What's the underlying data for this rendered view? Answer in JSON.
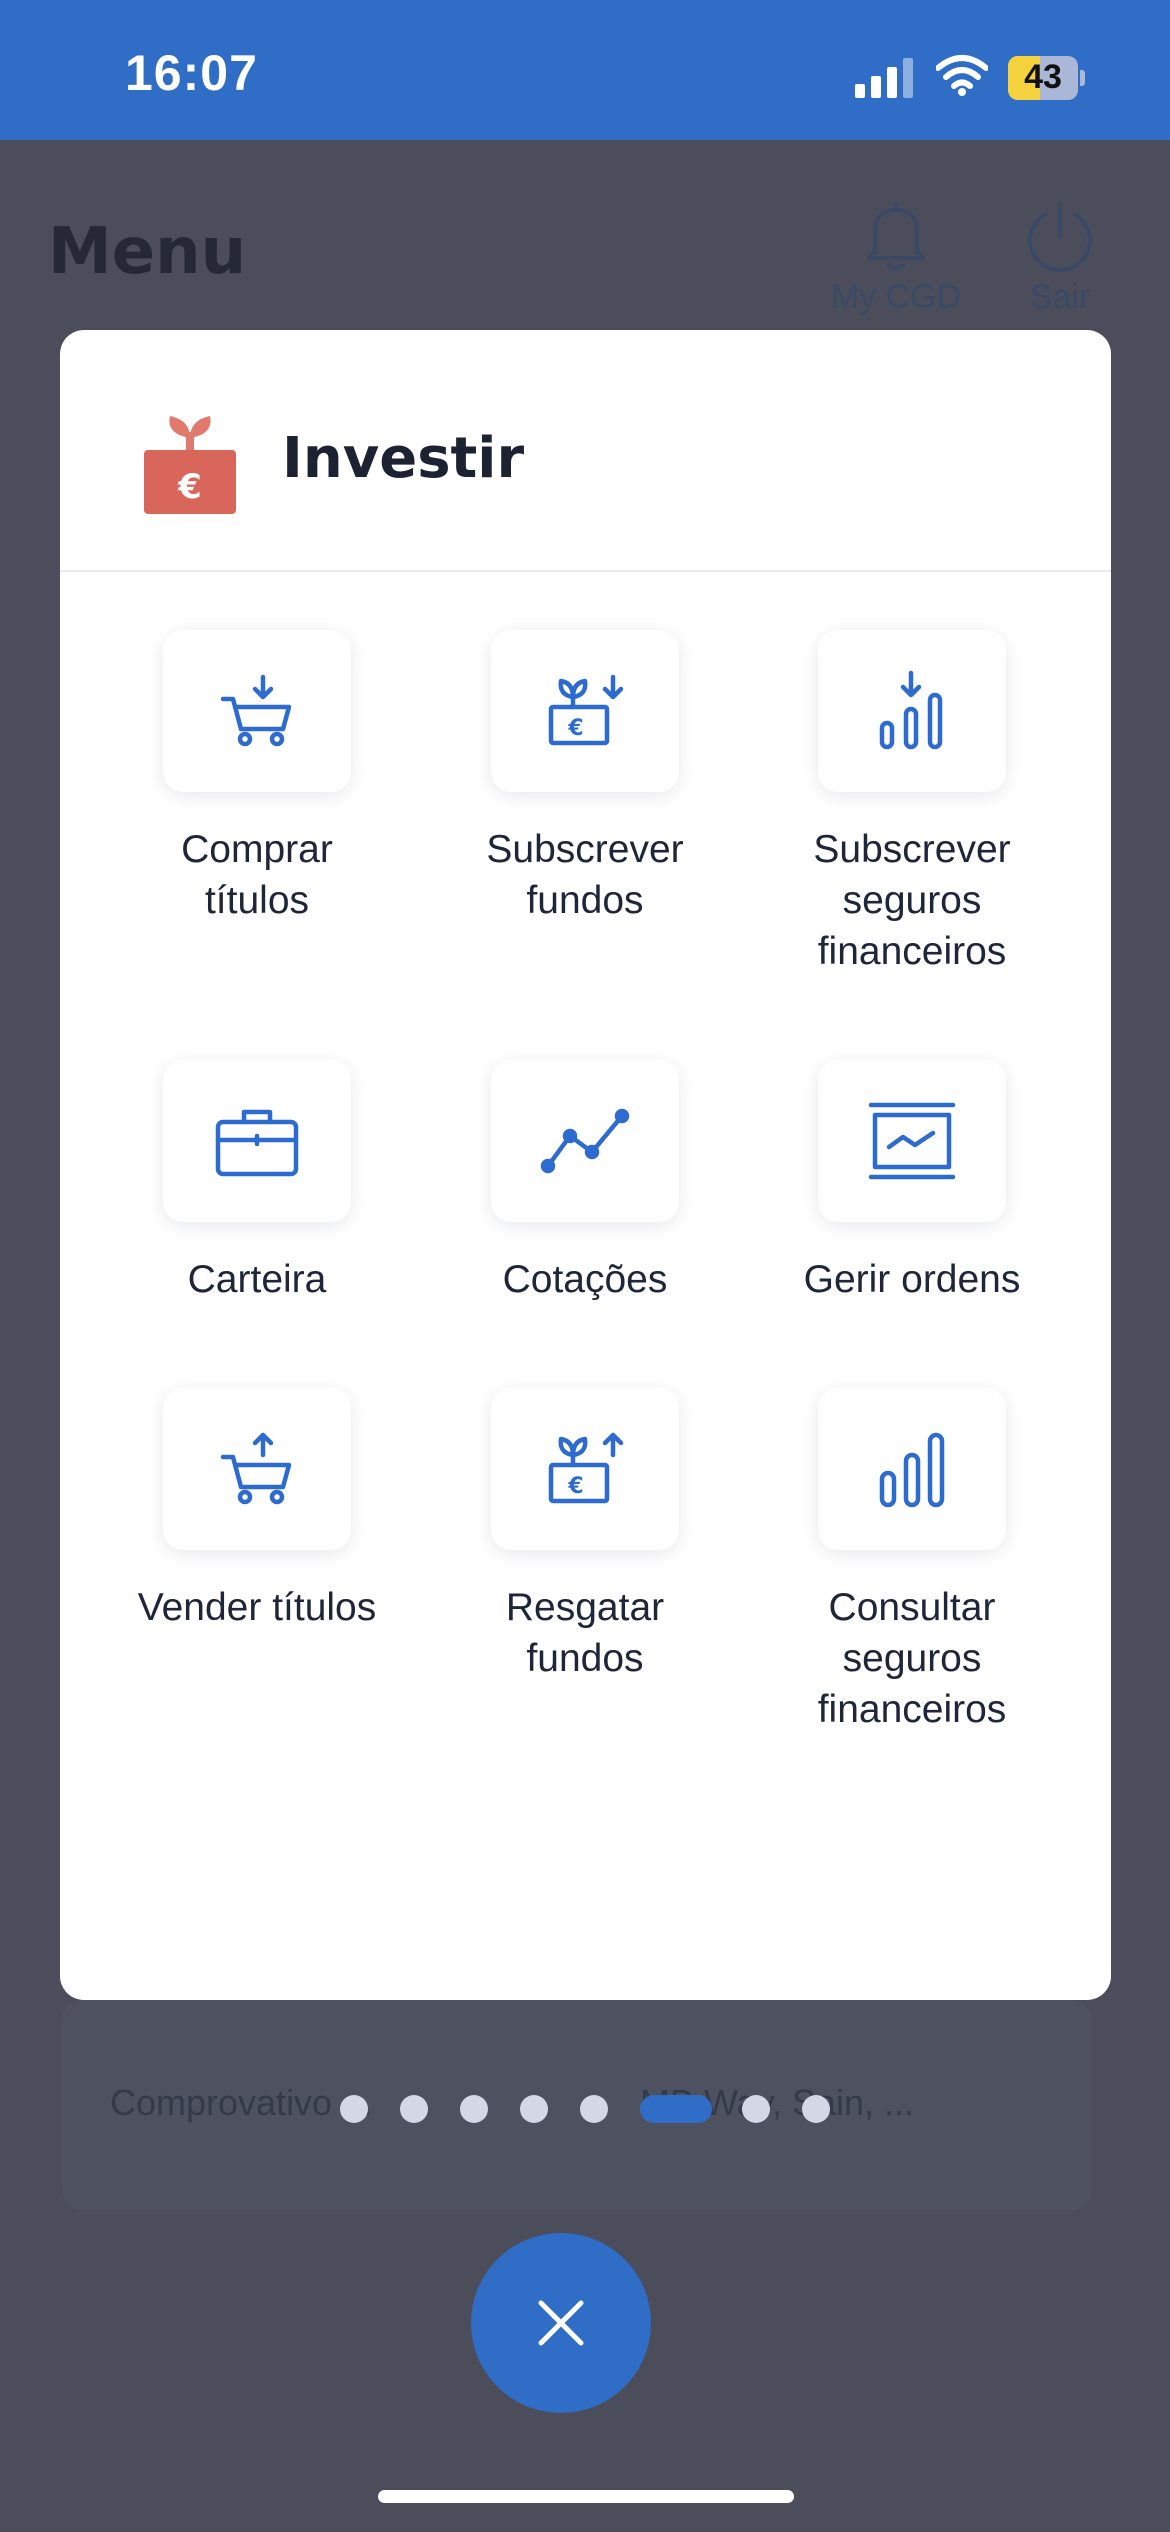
{
  "status_bar": {
    "time": "16:07",
    "battery": "43"
  },
  "background": {
    "title": "Menu",
    "my_cgd_label": "My CGD",
    "exit_label": "Sair",
    "card_text_left": "Comprovativo ...",
    "card_text_right": "MB Way, Sain, ..."
  },
  "modal": {
    "title": "Investir",
    "items": [
      {
        "line1": "Comprar",
        "line2": "títulos",
        "line3": ""
      },
      {
        "line1": "Subscrever",
        "line2": "fundos",
        "line3": ""
      },
      {
        "line1": "Subscrever",
        "line2": "seguros",
        "line3": "financeiros"
      },
      {
        "line1": "Carteira",
        "line2": "",
        "line3": ""
      },
      {
        "line1": "Cotações",
        "line2": "",
        "line3": ""
      },
      {
        "line1": "Gerir ordens",
        "line2": "",
        "line3": ""
      },
      {
        "line1": "Vender títulos",
        "line2": "",
        "line3": ""
      },
      {
        "line1": "Resgatar",
        "line2": "fundos",
        "line3": ""
      },
      {
        "line1": "Consultar",
        "line2": "seguros",
        "line3": "financeiros"
      }
    ]
  },
  "pagination": {
    "page_count": 8,
    "active_index": 5
  },
  "colors": {
    "accent": "#2f6dc7",
    "icon_blue": "#2e6bd0",
    "overlay": "#4b4e5a",
    "header_icon": "#d9665a"
  },
  "icons": [
    "cart-download-icon",
    "plant-euro-in-icon",
    "bar-chart-down-icon",
    "briefcase-icon",
    "line-chart-icon",
    "screen-chart-icon",
    "cart-upload-icon",
    "plant-euro-out-icon",
    "bar-chart-icon",
    "close-icon"
  ]
}
